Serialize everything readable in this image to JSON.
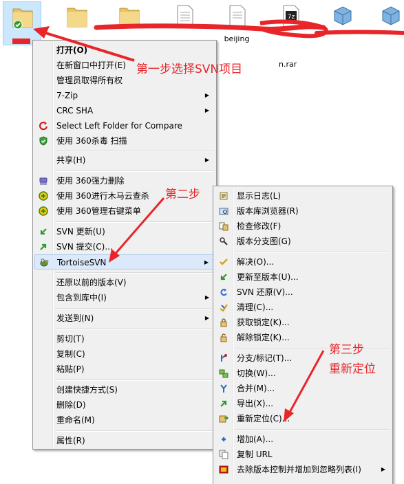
{
  "files": [
    {
      "label": "",
      "icon": "svn-folder-icon"
    },
    {
      "label": "",
      "icon": "folder-icon"
    },
    {
      "label": "",
      "icon": "folder-icon"
    },
    {
      "label": "",
      "icon": "text-file-icon"
    },
    {
      "label": "beijing ",
      "icon": "text-file-icon"
    },
    {
      "label": "",
      "icon": "7z-archive-icon"
    },
    {
      "label": "",
      "icon": "package-icon"
    },
    {
      "label": "",
      "icon": "package-icon"
    }
  ],
  "rar_label": "n.rar",
  "main_menu": {
    "items": [
      {
        "label": "打开(O)",
        "bold": true
      },
      {
        "label": "在新窗口中打开(E)"
      },
      {
        "label": "管理员取得所有权"
      },
      {
        "label": "7-Zip",
        "submenu": true
      },
      {
        "label": "CRC SHA",
        "submenu": true
      },
      {
        "label": "Select Left Folder for Compare",
        "icon": "compare-icon"
      },
      {
        "label": "使用 360杀毒 扫描",
        "icon": "shield-icon"
      },
      {
        "label": "共享(H)",
        "submenu": true
      },
      {
        "label": "使用 360强力删除",
        "icon": "shredder-icon"
      },
      {
        "label": "使用 360进行木马云查杀",
        "icon": "360-icon"
      },
      {
        "label": "使用 360管理右键菜单",
        "icon": "360-icon"
      },
      {
        "label": "SVN 更新(U)",
        "icon": "svn-update-icon"
      },
      {
        "label": "SVN 提交(C)...",
        "icon": "svn-commit-icon"
      },
      {
        "label": "TortoiseSVN",
        "icon": "tortoise-icon",
        "submenu": true,
        "highlighted": true
      },
      {
        "label": "还原以前的版本(V)"
      },
      {
        "label": "包含到库中(I)",
        "submenu": true
      },
      {
        "label": "发送到(N)",
        "submenu": true
      },
      {
        "label": "剪切(T)"
      },
      {
        "label": "复制(C)"
      },
      {
        "label": "粘贴(P)"
      },
      {
        "label": "创建快捷方式(S)"
      },
      {
        "label": "删除(D)"
      },
      {
        "label": "重命名(M)"
      },
      {
        "label": "属性(R)"
      }
    ]
  },
  "svn_menu": {
    "items": [
      {
        "label": "显示日志(L)",
        "icon": "log-icon"
      },
      {
        "label": "版本库浏览器(R)",
        "icon": "repo-browser-icon"
      },
      {
        "label": "检查修改(F)",
        "icon": "check-modifications-icon"
      },
      {
        "label": "版本分支图(G)",
        "icon": "revision-graph-icon"
      },
      {
        "label": "解决(O)...",
        "icon": "resolve-icon"
      },
      {
        "label": "更新至版本(U)...",
        "icon": "update-to-revision-icon"
      },
      {
        "label": "SVN 还原(V)...",
        "icon": "revert-icon"
      },
      {
        "label": "清理(C)...",
        "icon": "cleanup-icon"
      },
      {
        "label": "获取锁定(K)...",
        "icon": "lock-icon"
      },
      {
        "label": "解除锁定(K)...",
        "icon": "unlock-icon"
      },
      {
        "label": "分支/标记(T)...",
        "icon": "branch-icon"
      },
      {
        "label": "切换(W)...",
        "icon": "switch-icon"
      },
      {
        "label": "合并(M)...",
        "icon": "merge-icon"
      },
      {
        "label": "导出(X)...",
        "icon": "export-icon"
      },
      {
        "label": "重新定位(C)...",
        "icon": "relocate-icon"
      },
      {
        "label": "增加(A)...",
        "icon": "add-icon"
      },
      {
        "label": "复制 URL",
        "icon": "copy-url-icon"
      },
      {
        "label": "去除版本控制并增加到忽略列表(I)",
        "icon": "ignore-icon",
        "submenu": true
      }
    ]
  },
  "annotations": {
    "step1": "第一步选择SVN项目",
    "step2": "第二步",
    "step3_line1": "第三步",
    "step3_line2": "重新定位"
  },
  "submenu_arrow": "▶",
  "colors": {
    "annotation": "#e8262a",
    "highlight": "#dbe9fa",
    "menu_bg": "#f0f0f0"
  }
}
